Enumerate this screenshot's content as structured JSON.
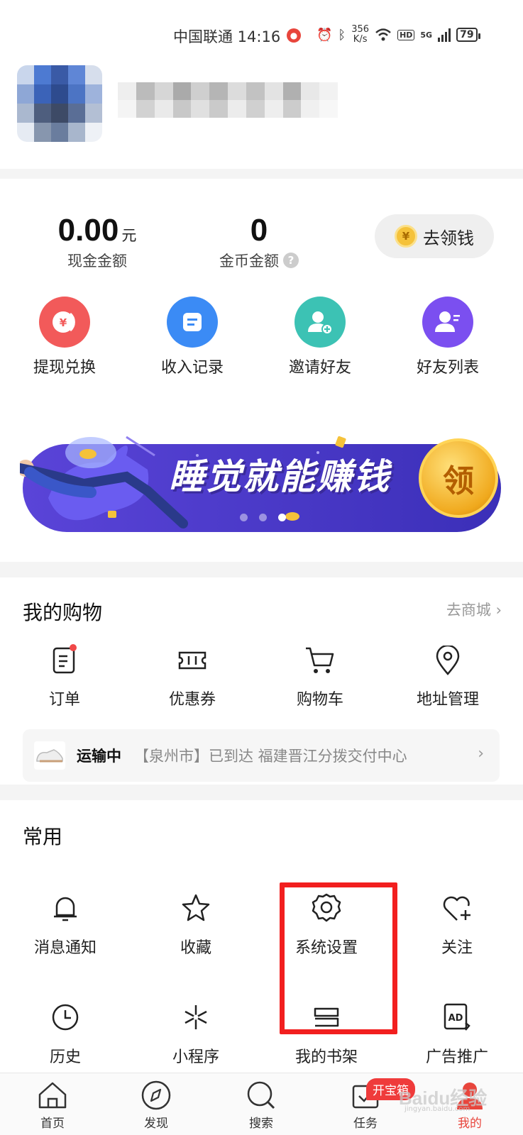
{
  "status_bar": {
    "carrier_time": "中国联通 14:16",
    "net_speed_value": "356",
    "net_speed_unit": "K/s",
    "hd": "HD",
    "network": "5G",
    "battery": "79"
  },
  "wallet": {
    "cash_amount": "0.00",
    "cash_unit": "元",
    "cash_label": "现金金额",
    "coin_amount": "0",
    "coin_label": "金币金额",
    "coin_help": "?",
    "claim_button": "去领钱",
    "claim_coin_symbol": "¥"
  },
  "quick_actions": [
    {
      "label": "提现兑换",
      "icon": "withdraw-icon",
      "color": "#f25a5a"
    },
    {
      "label": "收入记录",
      "icon": "record-icon",
      "color": "#3b8bf5"
    },
    {
      "label": "邀请好友",
      "icon": "invite-friend-icon",
      "color": "#3cc2b4"
    },
    {
      "label": "好友列表",
      "icon": "friend-list-icon",
      "color": "#7b4ff0"
    }
  ],
  "banner": {
    "text": "睡觉就能赚钱",
    "coin_text": "领",
    "active_dot": 3
  },
  "shopping": {
    "title": "我的购物",
    "link": "去商城",
    "link_arrow": "›",
    "items": [
      {
        "label": "订单",
        "icon": "order-icon"
      },
      {
        "label": "优惠券",
        "icon": "coupon-icon"
      },
      {
        "label": "购物车",
        "icon": "cart-icon"
      },
      {
        "label": "地址管理",
        "icon": "location-icon"
      }
    ],
    "shipping": {
      "status": "运输中",
      "detail": "【泉州市】已到达 福建晋江分拨交付中心",
      "arrow": "›"
    }
  },
  "common": {
    "title": "常用",
    "items": [
      {
        "label": "消息通知",
        "icon": "bell-icon"
      },
      {
        "label": "收藏",
        "icon": "star-icon"
      },
      {
        "label": "系统设置",
        "icon": "gear-icon"
      },
      {
        "label": "关注",
        "icon": "heart-plus-icon"
      },
      {
        "label": "历史",
        "icon": "clock-icon"
      },
      {
        "label": "小程序",
        "icon": "mini-program-icon"
      },
      {
        "label": "我的书架",
        "icon": "bookshelf-icon"
      },
      {
        "label": "广告推广",
        "icon": "ad-icon"
      }
    ]
  },
  "tab_bar": {
    "tabs": [
      {
        "label": "首页",
        "icon": "home-icon"
      },
      {
        "label": "发现",
        "icon": "compass-icon"
      },
      {
        "label": "搜索",
        "icon": "search-icon"
      },
      {
        "label": "任务",
        "icon": "task-icon"
      },
      {
        "label": "我的",
        "icon": "profile-icon",
        "active": true
      }
    ],
    "task_badge": "开宝箱"
  },
  "watermark": {
    "text": "Baidu经验",
    "sub": "jingyan.baidu.com"
  },
  "colors": {
    "accent": "#e8453c",
    "highlight_box": "#f21f1f",
    "banner_bg": "#4a3bd0"
  }
}
